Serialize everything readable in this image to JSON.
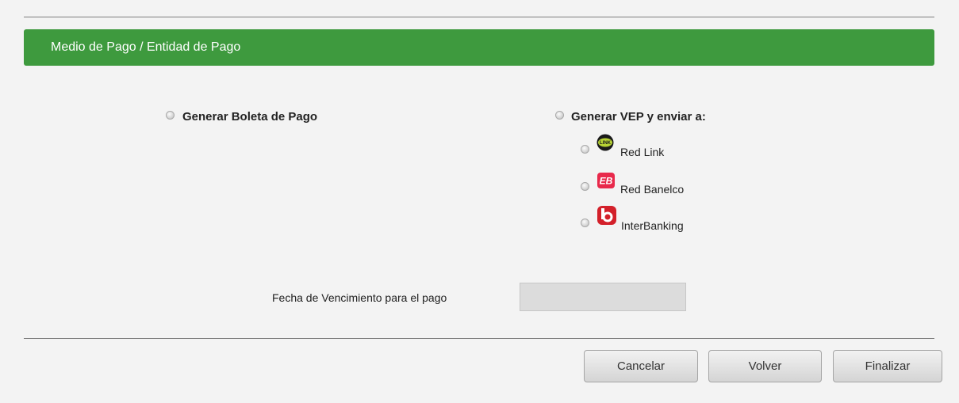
{
  "header": {
    "title": "Medio de Pago / Entidad de Pago"
  },
  "options": {
    "boleta_label": "Generar Boleta de Pago",
    "vep_label": "Generar VEP y enviar a:",
    "entities": [
      {
        "label": "Red Link",
        "icon": "red-link-logo-icon",
        "color": "#1a1a1a",
        "accent": "#b7d334",
        "logo_text": "LINK"
      },
      {
        "label": "Red Banelco",
        "icon": "banelco-logo-icon",
        "color": "#e8294b",
        "logo_text": "EB"
      },
      {
        "label": "InterBanking",
        "icon": "interbanking-logo-icon",
        "color": "#d3202a"
      }
    ]
  },
  "due_date": {
    "label": "Fecha de Vencimiento para el pago",
    "value": ""
  },
  "buttons": {
    "cancel": "Cancelar",
    "back": "Volver",
    "finish": "Finalizar"
  },
  "colors": {
    "header_bg": "#3e9a3e",
    "page_bg": "#f3f3f3"
  }
}
